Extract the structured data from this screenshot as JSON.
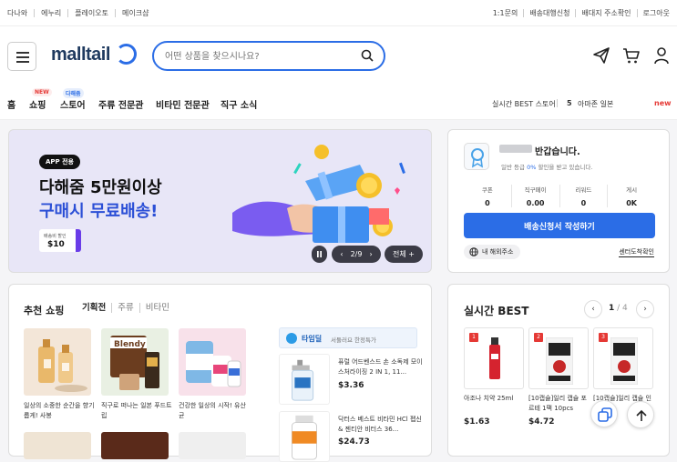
{
  "topbar": {
    "left": [
      "다나와",
      "에누리",
      "플레이오토",
      "메이크샵"
    ],
    "right": [
      "1:1문의",
      "배송대행신청",
      "배대지 주소확인",
      "로그아웃"
    ]
  },
  "header": {
    "logo": "malltail",
    "search_placeholder": "어떤 상품을 찾으시나요?"
  },
  "nav": {
    "items": [
      "홈",
      "쇼핑",
      "스토어",
      "주류 전문관",
      "비타민 전문관",
      "직구 소식"
    ],
    "badges": {
      "shopping": "NEW",
      "store": "다해줌"
    },
    "realtime_label": "실시간 BEST 스토어",
    "realtime_rank": "5",
    "realtime_store": "아마존 일본",
    "realtime_tag": "new"
  },
  "banner": {
    "tag": "APP 전용",
    "line1": "다해줌 5만원이상",
    "line2": "구매시 무료배송!",
    "coupon_label": "배송비 할인",
    "coupon_value": "$10",
    "page": "2/9",
    "all_label": "전체 +"
  },
  "profile": {
    "greeting": "반갑습니다.",
    "grade_prefix": "일반 등급 ",
    "grade_rate": "0%",
    "grade_suffix": " 할인을 받고 있습니다.",
    "stats": [
      {
        "k": "쿠폰",
        "v": "0"
      },
      {
        "k": "직구페이",
        "v": "0.00"
      },
      {
        "k": "리워드",
        "v": "0"
      },
      {
        "k": "게시",
        "v": "0K"
      }
    ],
    "cta": "배송신청서 작성하기",
    "address_btn": "내 해외주소",
    "center_link": "센터도착확인"
  },
  "recommend": {
    "title": "추천 쇼핑",
    "tabs": [
      "기획전",
      "주류",
      "비타민"
    ],
    "cards": [
      {
        "text": "일상의 소중한 순간을 향기롭게! 사봉",
        "image": "perfume-bottles"
      },
      {
        "text": "직구로 떠나는 일본 푸드트립",
        "image": "blendy-coffee"
      },
      {
        "text": "건강한 일상의 시작! 유산균",
        "image": "probiotics"
      }
    ],
    "tadeal": {
      "name": "타임딜",
      "desc": "서둘러요 한정특가"
    },
    "deals": [
      {
        "name": "퓨럴 어드벤스드 손 소독제 모이스처라이징 2 IN 1, 11...",
        "price": "$3.36"
      },
      {
        "name": "닥터스 베스트 비타민 HCl 펩신 & 젠티안 비터스 36...",
        "price": "$24.73"
      }
    ]
  },
  "best": {
    "title": "실시간 BEST",
    "page_current": "1",
    "page_total": "/ 4",
    "items": [
      {
        "rank": "1",
        "name": "아조나 치약 25ml",
        "name2": "",
        "price": "$1.63"
      },
      {
        "rank": "2",
        "name": "[10캡슐]일리 캡슐 포",
        "name2": "르테 1팩 10pcs",
        "price": "$4.72"
      },
      {
        "rank": "3",
        "name": "[10캡슐]일리 캡슐 인",
        "name2": "",
        "price": ""
      }
    ]
  },
  "colors": {
    "accent": "#2b6de6",
    "rank": "#e53935",
    "new_tag": "#e53935"
  }
}
